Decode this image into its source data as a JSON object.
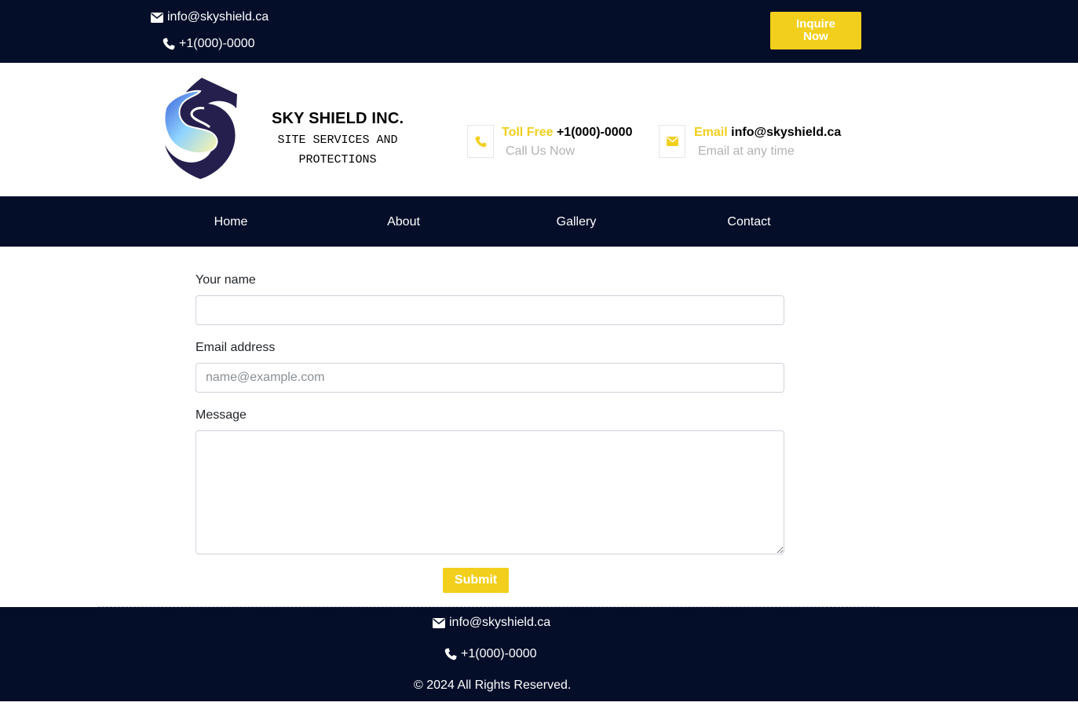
{
  "topbar": {
    "email": "info@skyshield.ca",
    "phone": "+1(000)-0000",
    "inquire_label": "Inquire Now",
    "email_icon": "envelope-icon",
    "phone_icon": "phone-icon"
  },
  "header": {
    "brand_title": "SKY SHIELD INC.",
    "brand_subtitle": "SITE SERVICES AND PROTECTIONS",
    "logo_icon": "shield-logo",
    "toll_label": "Toll Free",
    "toll_value": "+1(000)-0000",
    "toll_sub": "Call Us Now",
    "email_label": "Email",
    "email_value": "info@skyshield.ca",
    "email_sub": "Email at any time"
  },
  "nav": {
    "items": [
      {
        "label": "Home"
      },
      {
        "label": "About"
      },
      {
        "label": "Gallery"
      },
      {
        "label": "Contact"
      }
    ]
  },
  "form": {
    "name_label": "Your name",
    "name_value": "",
    "email_label": "Email address",
    "email_placeholder": "name@example.com",
    "message_label": "Message",
    "message_value": "",
    "submit_label": "Submit"
  },
  "footer": {
    "email": "info@skyshield.ca",
    "phone": "+1(000)-0000",
    "copyright": "© 2024 All Rights Reserved."
  },
  "colors": {
    "navy": "#050e29",
    "accent": "#f2cf1c",
    "muted": "#b3b3b3"
  }
}
